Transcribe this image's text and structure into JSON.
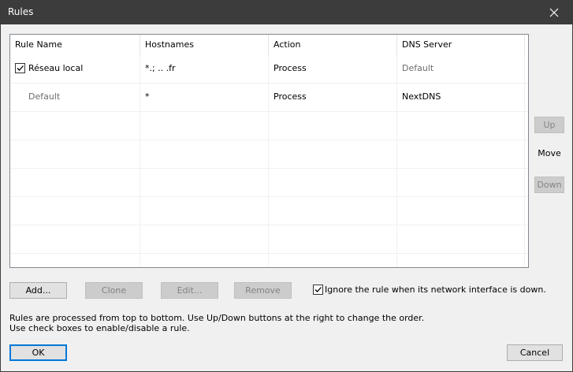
{
  "window": {
    "title": "Rules"
  },
  "table": {
    "columns": [
      "Rule Name",
      "Hostnames",
      "Action",
      "DNS Server"
    ],
    "rows": [
      {
        "checked": true,
        "rule_name": "Réseau local",
        "hostnames": "*.;   ..     .fr",
        "action": "Process",
        "dns_server": "Default"
      },
      {
        "checked": false,
        "rule_name": "Default",
        "hostnames": "*",
        "action": "Process",
        "dns_server": "NextDNS"
      }
    ]
  },
  "buttons": {
    "add": "Add...",
    "clone": "Clone",
    "edit": "Edit...",
    "remove": "Remove",
    "up": "Up",
    "down": "Down",
    "ok": "OK",
    "cancel": "Cancel"
  },
  "move_label": "Move",
  "ignore_option": {
    "checked": true,
    "label": "Ignore the rule when its network interface is down."
  },
  "info": {
    "line1": "Rules are processed from top to bottom. Use Up/Down buttons at the right to change the order.",
    "line2": "Use check boxes to enable/disable a rule."
  },
  "icons": {
    "close": "close-icon",
    "check": "check-icon"
  }
}
